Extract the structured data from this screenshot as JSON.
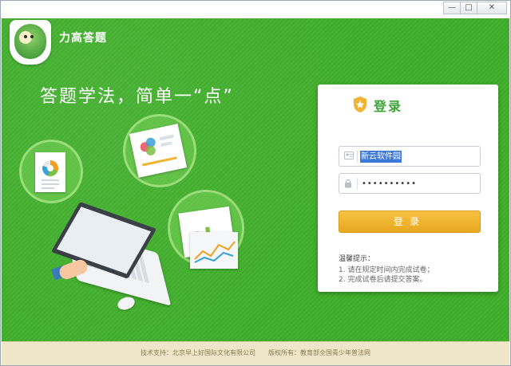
{
  "window": {
    "buttons": {
      "minimize": "—",
      "maximize": "□",
      "close": "✕"
    }
  },
  "app": {
    "title": "力高答题",
    "logo_icon": "frog-mascot-logo",
    "slogan": "答题学法，简单一“点”"
  },
  "login": {
    "title": "登录",
    "title_icon": "shield-icon",
    "username": {
      "value": "新云软件园",
      "icon": "id-card-icon"
    },
    "password": {
      "masked_value": "••••••••••",
      "icon": "lock-icon"
    },
    "button_label": "登录",
    "tips_title": "温馨提示：",
    "tips": [
      "1. 请在规定时间内完成试卷；",
      "2. 完成试卷后请提交答案。"
    ]
  },
  "footer": {
    "text": "技术支持：北京早上好国际文化有限公司　　版权所有：教育部全国青少年普法网"
  },
  "colors": {
    "background_green": "#3fae2a",
    "login_title_green": "#3aa534",
    "button_orange": "#f0b432",
    "footer_beige": "#efe6c9"
  }
}
